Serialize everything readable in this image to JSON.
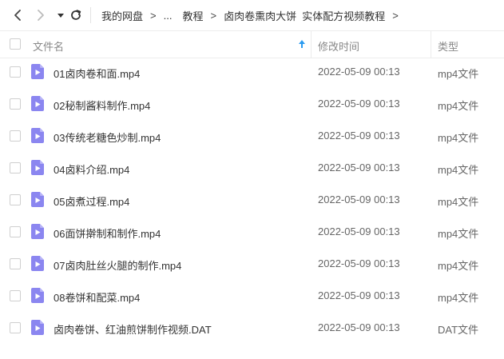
{
  "breadcrumb": {
    "items": [
      "我的网盘",
      "...",
      "教程",
      "卤肉卷熏肉大饼  实体配方视频教程"
    ],
    "separator": ">"
  },
  "table": {
    "columns": {
      "name": "文件名",
      "mtime": "修改时间",
      "type": "类型"
    },
    "sort": {
      "column": "name",
      "direction": "ascending"
    },
    "rows": [
      {
        "name": "01卤肉卷和面.mp4",
        "mtime": "2022-05-09 00:13",
        "type": "mp4文件",
        "icon": "video-file-icon"
      },
      {
        "name": "02秘制酱料制作.mp4",
        "mtime": "2022-05-09 00:13",
        "type": "mp4文件",
        "icon": "video-file-icon"
      },
      {
        "name": "03传统老糖色炒制.mp4",
        "mtime": "2022-05-09 00:13",
        "type": "mp4文件",
        "icon": "video-file-icon"
      },
      {
        "name": "04卤料介绍.mp4",
        "mtime": "2022-05-09 00:13",
        "type": "mp4文件",
        "icon": "video-file-icon"
      },
      {
        "name": "05卤煮过程.mp4",
        "mtime": "2022-05-09 00:13",
        "type": "mp4文件",
        "icon": "video-file-icon"
      },
      {
        "name": "06面饼擀制和制作.mp4",
        "mtime": "2022-05-09 00:13",
        "type": "mp4文件",
        "icon": "video-file-icon"
      },
      {
        "name": "07卤肉肚丝火腿的制作.mp4",
        "mtime": "2022-05-09 00:13",
        "type": "mp4文件",
        "icon": "video-file-icon"
      },
      {
        "name": "08卷饼和配菜.mp4",
        "mtime": "2022-05-09 00:13",
        "type": "mp4文件",
        "icon": "video-file-icon"
      },
      {
        "name": "卤肉卷饼、红油煎饼制作视频.DAT",
        "mtime": "2022-05-09 00:13",
        "type": "DAT文件",
        "icon": "video-file-icon"
      }
    ]
  },
  "colors": {
    "icon_purple": "#8b86f0",
    "sort_arrow": "#2b9bf0",
    "text": "#333333",
    "muted": "#888888"
  }
}
